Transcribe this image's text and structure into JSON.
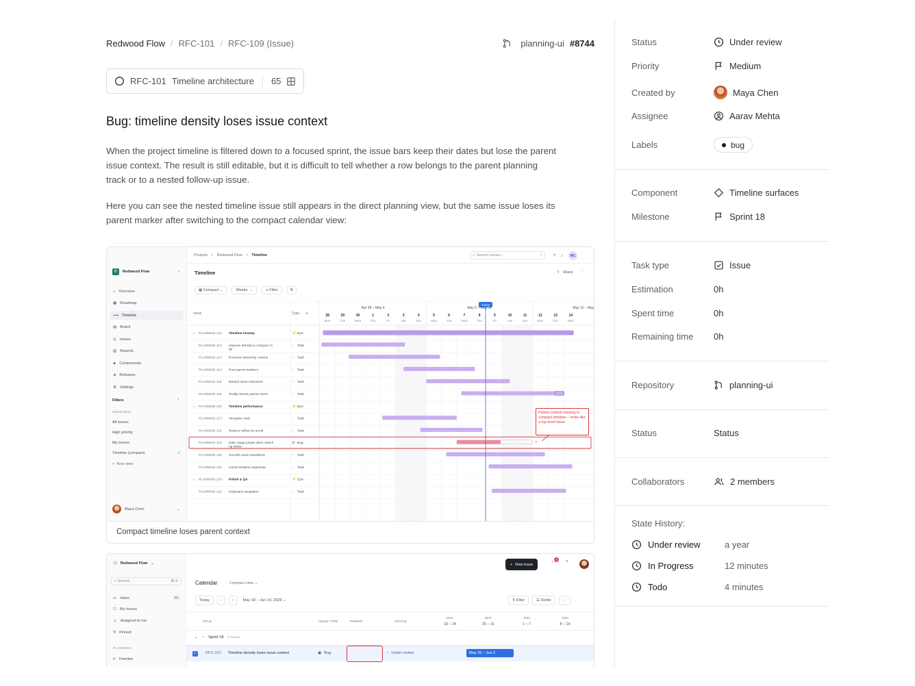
{
  "breadcrumb": {
    "workspace": "Redwood Flow",
    "parent": "RFC-101",
    "current": "RFC-109 (Issue)"
  },
  "repo": {
    "name": "planning-ui",
    "pr": "#8744"
  },
  "parent_chip": {
    "id": "RFC-101",
    "name": "Timeline architecture",
    "count": "65"
  },
  "issue": {
    "title": "Bug: timeline density loses issue context",
    "para1": "When the project timeline is filtered down to a focused sprint, the issue bars keep their dates but lose the parent issue context. The result is still editable, but it is difficult to tell whether a row belongs to the parent planning track or to a nested follow-up issue.",
    "para2": "Here you can see the nested timeline issue still appears in the direct planning view, but the same issue loses its parent marker after switching to the compact calendar view:"
  },
  "shot1": {
    "caption": "Compact timeline loses parent context",
    "crumbs": [
      "Projects",
      "Redwood Flow",
      "Timeline"
    ],
    "search": "Search issues...",
    "search_key": "/",
    "avatar": "MC",
    "workspace": "Redwood Flow",
    "nav": [
      "Overview",
      "Roadmap",
      "Timeline",
      "Board",
      "Issues",
      "Reports",
      "Components",
      "Releases",
      "Settings"
    ],
    "filters_title": "Filters",
    "saved_views": "Saved views",
    "views": [
      "All issues",
      "High priority",
      "My issues",
      "Timeline (compact)"
    ],
    "new_view": "New view",
    "user": "Maya Chen",
    "header": "Timeline",
    "share": "Share",
    "controls": {
      "compact": "Compact",
      "weeks": "Weeks",
      "filter": "Filter"
    },
    "col_issue": "Issue",
    "col_type": "Type",
    "weeks": [
      "Apr 28 – May 4",
      "May 5 – May 11",
      "May 12 – May 18"
    ],
    "today": "Today",
    "days": [
      [
        "28",
        "Mon"
      ],
      [
        "29",
        "Tue"
      ],
      [
        "30",
        "Wed"
      ],
      [
        "1",
        "Thu"
      ],
      [
        "2",
        "Fri"
      ],
      [
        "3",
        "Sat"
      ],
      [
        "4",
        "Sun"
      ],
      [
        "5",
        "Mon"
      ],
      [
        "6",
        "Tue"
      ],
      [
        "7",
        "Wed"
      ],
      [
        "8",
        "Thu"
      ],
      [
        "9",
        "Fri"
      ],
      [
        "10",
        "Sat"
      ],
      [
        "11",
        "Sun"
      ],
      [
        "12",
        "Mon"
      ],
      [
        "13",
        "Tue"
      ],
      [
        "14",
        "Wed"
      ]
    ],
    "rows": [
      {
        "id": "PLANNING-101",
        "name": "Timeline revamp",
        "type": "Epic",
        "group": true,
        "start": 0.2,
        "end": 16.7,
        "color": "#b99be8"
      },
      {
        "id": "PLANNING-112",
        "name": "Improve density in compact mode",
        "type": "Task",
        "start": 0.1,
        "end": 5.6,
        "color": "#c9aef0"
      },
      {
        "id": "PLANNING-113",
        "name": "Preserve hierarchy context",
        "type": "Task",
        "start": 1.9,
        "end": 7.9,
        "color": "#c9aef0"
      },
      {
        "id": "PLANNING-114",
        "name": "Row parent markers",
        "type": "Task",
        "start": 5.5,
        "end": 10.2,
        "color": "#c9aef0"
      },
      {
        "id": "PLANNING-115",
        "name": "Nested issue indicators",
        "type": "Task",
        "start": 7.0,
        "end": 12.5,
        "color": "#c9aef0"
      },
      {
        "id": "PLANNING-116",
        "name": "Tooltip shows parent name",
        "type": "Task",
        "start": 9.3,
        "end": 16.1,
        "color": "#c9aef0"
      },
      {
        "id": "PLANNING-102",
        "name": "Timeline performance",
        "type": "Epic",
        "group": true
      },
      {
        "id": "PLANNING-117",
        "name": "Virtualize rows",
        "type": "Task",
        "start": 4.1,
        "end": 9.0,
        "color": "#c9aef0"
      },
      {
        "id": "PLANNING-118",
        "name": "Reduce reflow on scroll",
        "type": "Task",
        "start": 6.6,
        "end": 10.7,
        "color": "#c9aef0"
      },
      {
        "id": "PLANNING-119",
        "name": "Date range jumps when switching views",
        "type": "Bug",
        "bug": true,
        "start": 9.0,
        "end": 11.9,
        "color": "#ef8aa0"
      },
      {
        "id": "PLANNING-120",
        "name": "Smooth zoom transitions",
        "type": "Task",
        "start": 8.3,
        "end": 14.8,
        "color": "#c9aef0"
      },
      {
        "id": "PLANNING-121",
        "name": "Cache timeline segments",
        "type": "Task",
        "start": 11.1,
        "end": 16.6,
        "color": "#c9aef0"
      },
      {
        "id": "PLANNING-103",
        "name": "Polish & QA",
        "type": "Epic",
        "group": true
      },
      {
        "id": "PLANNING-122",
        "name": "Keyboard navigation",
        "type": "Task",
        "start": 11.3,
        "end": 16.2,
        "color": "#c9aef0"
      }
    ],
    "callout": "Parent context missing in compact timeline – looks like a top-level issue"
  },
  "shot2": {
    "workspace": "Redwood Flow",
    "new_issue": "New issue",
    "badge": "3",
    "search": "Search",
    "search_key": "⌘ K",
    "nav": [
      {
        "label": "Inbox",
        "count": "12"
      },
      {
        "label": "My issues"
      },
      {
        "label": "Assigned to me"
      },
      {
        "label": "Pinned"
      }
    ],
    "section": "PLANNING",
    "nav2": "Timeline",
    "tab": "Calendar",
    "view": "Compact view",
    "today": "Today",
    "range": "May 18 – Jun 14, 2026",
    "filter": "Filter",
    "fields": "Fields",
    "cols": [
      "TITLE",
      "ISSUE TYPE",
      "PARENT",
      "STATUS"
    ],
    "weeks": [
      [
        "MAY",
        "18 – 24"
      ],
      [
        "MAY",
        "25 – 31"
      ],
      [
        "JUN",
        "1 – 7"
      ],
      [
        "JUN",
        "8 – 14"
      ]
    ],
    "group": "Sprint 18",
    "group_count": "8 issues",
    "row": {
      "id": "RFC-101",
      "title": "Timeline density loses issue context",
      "type": "Bug",
      "status": "Under review",
      "bar": "May 26 – Jun 2"
    }
  },
  "sidebar": {
    "props1": [
      {
        "k": "Status",
        "v": "Under review",
        "icon": "clock-icon"
      },
      {
        "k": "Priority",
        "v": "Medium",
        "icon": "flag-icon"
      },
      {
        "k": "Created by",
        "v": "Maya Chen",
        "icon": "avatar"
      },
      {
        "k": "Assignee",
        "v": "Aarav Mehta",
        "icon": "user-circle-icon"
      },
      {
        "k": "Labels",
        "v": "bug",
        "icon": "dot-icon"
      }
    ],
    "props2": [
      {
        "k": "Component",
        "v": "Timeline surfaces",
        "icon": "diamond-icon"
      },
      {
        "k": "Milestone",
        "v": "Sprint 18",
        "icon": "flag-icon"
      }
    ],
    "props3": [
      {
        "k": "Task type",
        "v": "Issue",
        "icon": "check-square-icon"
      },
      {
        "k": "Estimation",
        "v": "0h"
      },
      {
        "k": "Spent time",
        "v": "0h"
      },
      {
        "k": "Remaining time",
        "v": "0h"
      }
    ],
    "repository": {
      "k": "Repository",
      "v": "planning-ui"
    },
    "status2": {
      "k": "Status",
      "v": "Status"
    },
    "collaborators": {
      "k": "Collaborators",
      "v": "2 members"
    },
    "history_title": "State History:",
    "history": [
      {
        "state": "Under review",
        "ago": "a year"
      },
      {
        "state": "In Progress",
        "ago": "12 minutes"
      },
      {
        "state": "Todo",
        "ago": "4 minutes"
      }
    ]
  }
}
